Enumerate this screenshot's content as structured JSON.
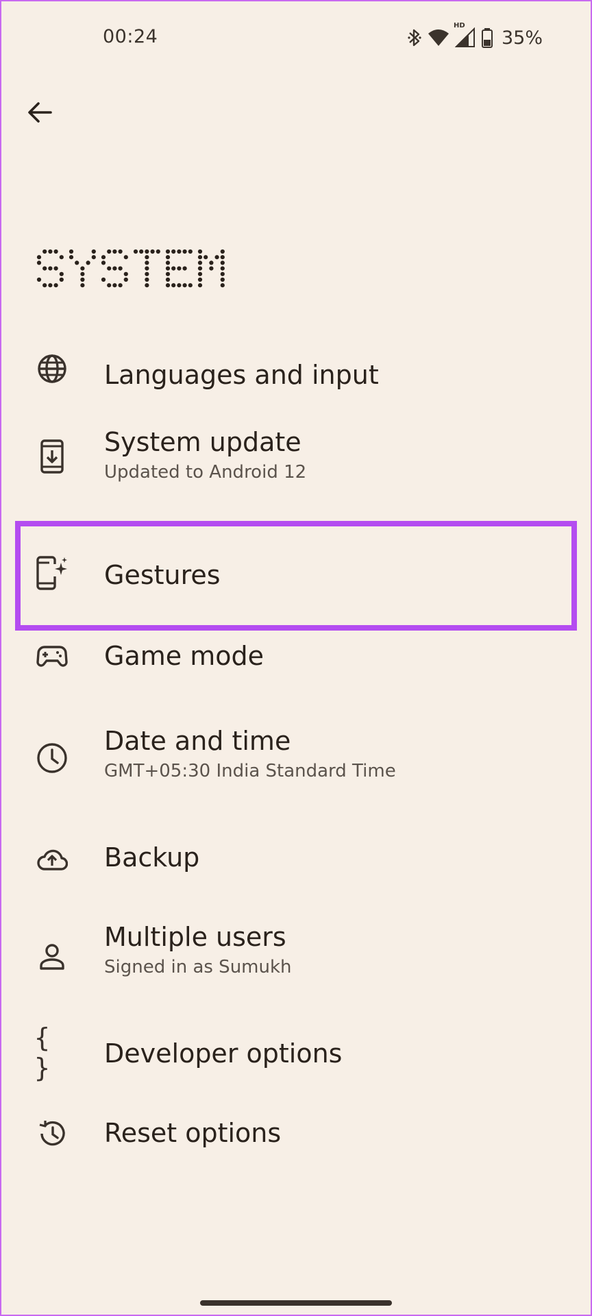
{
  "status_bar": {
    "time": "00:24",
    "battery": "35%",
    "network_badge": "HD"
  },
  "page": {
    "title": "SYSTEM"
  },
  "items": [
    {
      "title": "Languages and input",
      "subtitle": "",
      "icon": "globe-icon"
    },
    {
      "title": "System update",
      "subtitle": "Updated to Android 12",
      "icon": "system-update-icon"
    },
    {
      "title": "Gestures",
      "subtitle": "",
      "icon": "gestures-icon"
    },
    {
      "title": "Game mode",
      "subtitle": "",
      "icon": "gamepad-icon"
    },
    {
      "title": "Date and time",
      "subtitle": "GMT+05:30 India Standard Time",
      "icon": "clock-icon"
    },
    {
      "title": "Backup",
      "subtitle": "",
      "icon": "cloud-upload-icon"
    },
    {
      "title": "Multiple users",
      "subtitle": "Signed in as Sumukh",
      "icon": "person-icon"
    },
    {
      "title": "Developer options",
      "subtitle": "",
      "icon": "braces-icon"
    },
    {
      "title": "Reset options",
      "subtitle": "",
      "icon": "history-icon"
    }
  ],
  "colors": {
    "background": "#f7efe6",
    "highlight": "#b44cf0",
    "text": "#2a221c"
  }
}
